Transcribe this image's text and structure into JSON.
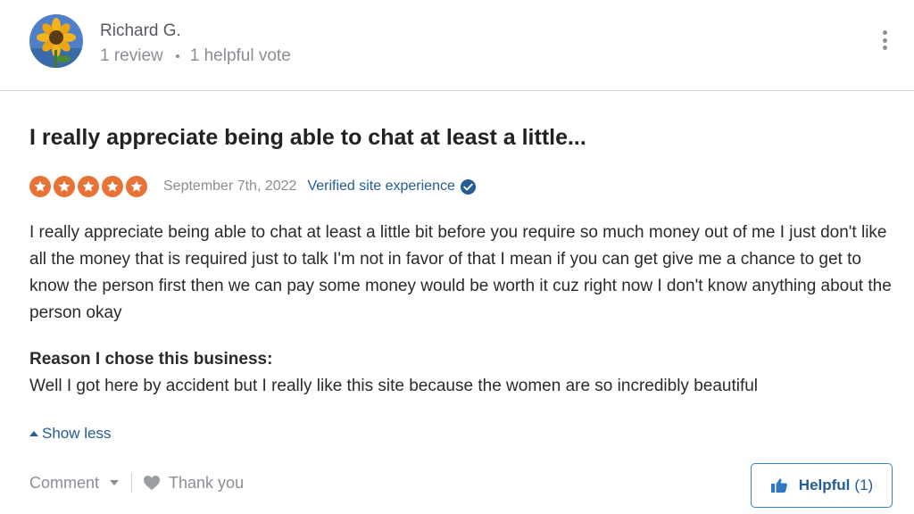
{
  "reviewer": {
    "name": "Richard G.",
    "review_count": "1 review",
    "helpful_votes": "1 helpful vote",
    "avatar": "sunflower-photo"
  },
  "review": {
    "title": "I really appreciate being able to chat at least a little...",
    "rating": 5,
    "rating_max": 5,
    "date": "September 7th, 2022",
    "verified_label": "Verified site experience",
    "body": "I really appreciate being able to chat at least a little bit before you require so much money out of me I just don't like all the money that is required just to talk I'm not in favor of that I mean if you can get give me a chance to get to know the person first then we can pay some money would be worth it cuz right now I don't know anything about the person okay",
    "reason_label": "Reason I chose this business:",
    "reason_text": "Well I got here by accident but I really like this site because the women are so incredibly beautiful",
    "show_less_label": "Show less"
  },
  "actions": {
    "comment_label": "Comment",
    "thank_you_label": "Thank you",
    "helpful_label": "Helpful",
    "helpful_count": "(1)"
  },
  "colors": {
    "star": "#e97237",
    "link": "#245c97",
    "muted": "#8a8f94",
    "helpful_border": "#3a7fc1"
  },
  "icons": [
    "more-options-icon",
    "star-icon",
    "verified-check-icon",
    "caret-up-icon",
    "caret-down-icon",
    "heart-icon",
    "thumbs-up-icon"
  ]
}
